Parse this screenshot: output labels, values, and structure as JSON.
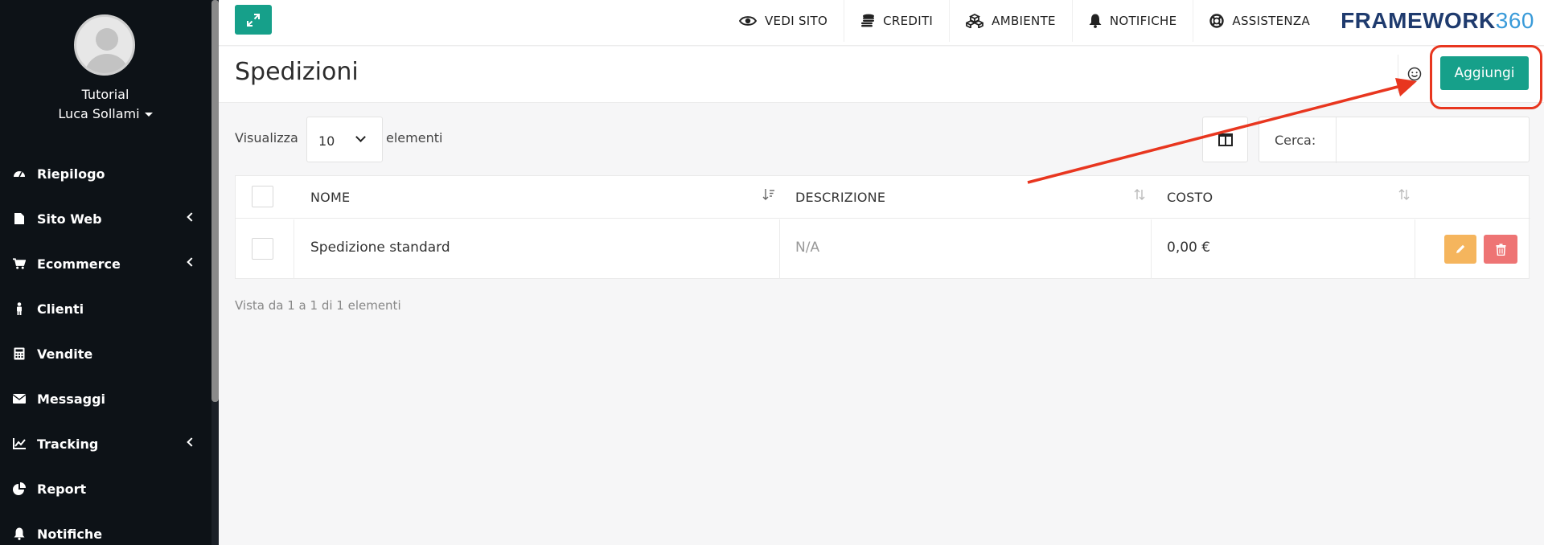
{
  "sidebar": {
    "company": "Tutorial",
    "user": "Luca Sollami",
    "items": [
      {
        "label": "Riepilogo",
        "icon": "dashboard-icon",
        "submenu": false
      },
      {
        "label": "Sito Web",
        "icon": "file-icon",
        "submenu": true
      },
      {
        "label": "Ecommerce",
        "icon": "cart-icon",
        "submenu": true
      },
      {
        "label": "Clienti",
        "icon": "person-icon",
        "submenu": false
      },
      {
        "label": "Vendite",
        "icon": "calculator-icon",
        "submenu": false
      },
      {
        "label": "Messaggi",
        "icon": "envelope-icon",
        "submenu": false
      },
      {
        "label": "Tracking",
        "icon": "line-chart-icon",
        "submenu": true
      },
      {
        "label": "Report",
        "icon": "pie-chart-icon",
        "submenu": false
      },
      {
        "label": "Notifiche",
        "icon": "bell-icon",
        "submenu": false
      }
    ]
  },
  "topbar": {
    "items": [
      {
        "label": "VEDI SITO",
        "icon": "eye-icon"
      },
      {
        "label": "CREDITI",
        "icon": "coins-icon"
      },
      {
        "label": "AMBIENTE",
        "icon": "cubes-icon"
      },
      {
        "label": "NOTIFICHE",
        "icon": "bell-icon"
      },
      {
        "label": "ASSISTENZA",
        "icon": "lifebuoy-icon"
      }
    ],
    "logo_text": "FRAMEWORK",
    "logo_num": "360"
  },
  "page": {
    "title": "Spedizioni",
    "add_label": "Aggiungi"
  },
  "controls": {
    "show_label": "Visualizza",
    "page_length": "10",
    "elements_label": "elementi",
    "search_label": "Cerca:",
    "search_value": ""
  },
  "table": {
    "headers": [
      "NOME",
      "DESCRIZIONE",
      "COSTO"
    ],
    "rows": [
      {
        "nome": "Spedizione standard",
        "descrizione": "N/A",
        "costo": "0,00 €"
      }
    ],
    "info": "Vista da 1 a 1 di 1 elementi"
  },
  "colors": {
    "accent": "#16a08a",
    "edit": "#f5b55d",
    "delete": "#ee7474",
    "annotation": "#e8361f",
    "sidebar_bg": "#0d1217"
  }
}
